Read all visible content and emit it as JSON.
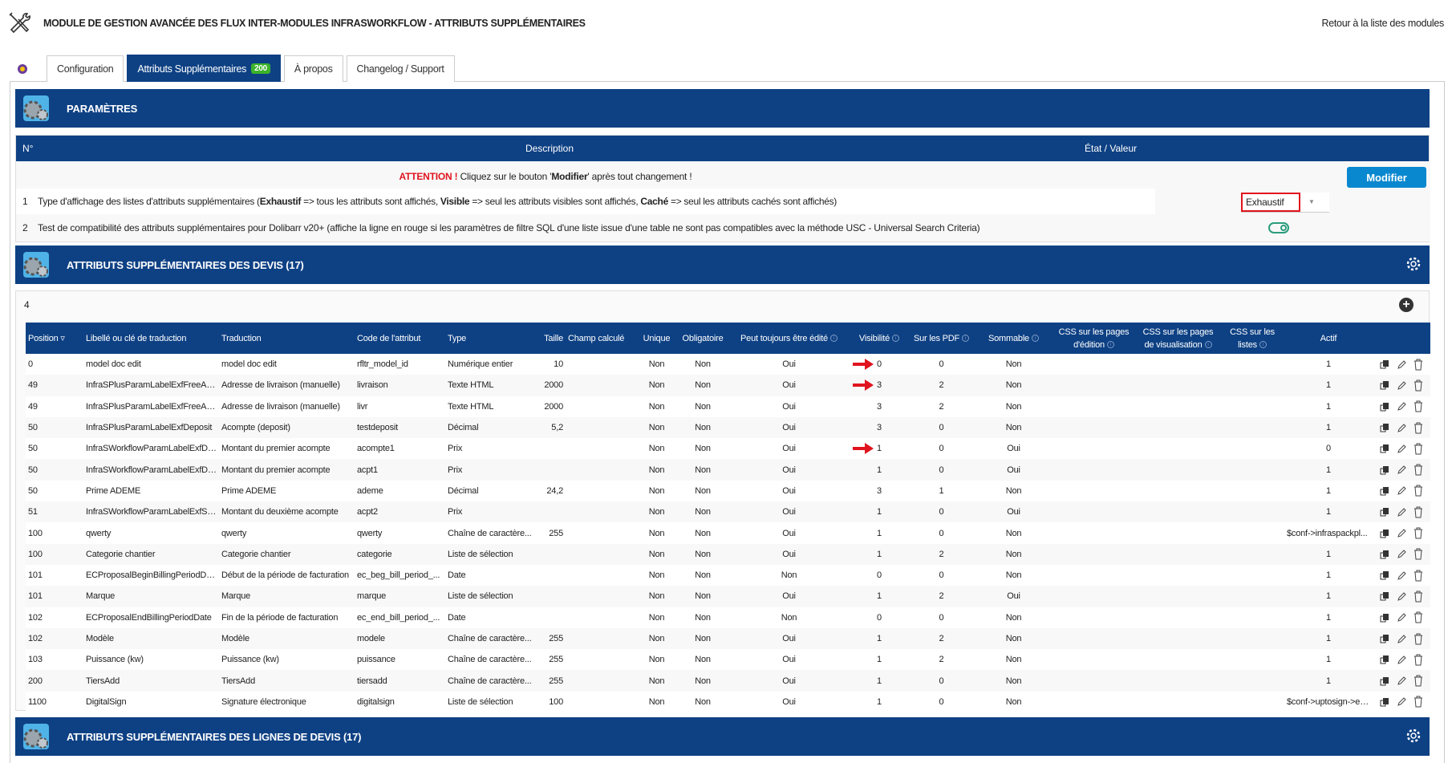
{
  "header": {
    "title": "MODULE DE GESTION AVANCÉE DES FLUX INTER-MODULES INFRASWORKFLOW - ATTRIBUTS SUPPLÉMENTAIRES",
    "back_link": "Retour à la liste des modules"
  },
  "tabs": [
    {
      "label": "Configuration"
    },
    {
      "label": "Attributs Supplémentaires",
      "badge": "200",
      "active": true
    },
    {
      "label": "À propos"
    },
    {
      "label": "Changelog / Support"
    }
  ],
  "params": {
    "title": "PARAMÈTRES",
    "col_num": "N°",
    "col_desc": "Description",
    "col_state": "État / Valeur",
    "attention_label": "ATTENTION !",
    "attention_pre": " Cliquez sur le bouton '",
    "attention_bold": "Modifier",
    "attention_post": "' après tout changement !",
    "modify_button": "Modifier",
    "row1_num": "1",
    "row1_text": "Type d'affichage des listes d'attributs supplémentaires (<b>Exhaustif</b> => tous les attributs sont affichés, <b>Visible</b> => seul les attributs visibles sont affichés, <b>Caché</b> => seul les attributs cachés sont affichés)",
    "row1_value": "Exhaustif",
    "row2_num": "2",
    "row2_text": "Test de compatibilité des attributs supplémentaires pour Dolibarr v20+ (affiche la ligne en rouge si les paramètres de filtre SQL d'une liste issue d'une table ne sont pas compatibles avec la méthode USC - Universal Search Criteria)",
    "row2_toggle_on": true
  },
  "devis": {
    "title": "ATTRIBUTS SUPPLÉMENTAIRES DES DEVIS (17)",
    "count": "4",
    "columns": [
      "Position ▿",
      "Libellé ou clé de traduction",
      "Traduction",
      "Code de l'attribut",
      "Type",
      "Taille",
      "Champ calculé",
      "Unique",
      "Obligatoire",
      "Peut toujours être édité",
      "Visibilité",
      "Sur les PDF",
      "Sommable",
      "CSS sur les pages d'édition",
      "CSS sur les pages de visualisation",
      "CSS sur les listes",
      "Actif"
    ],
    "rows": [
      [
        "0",
        "model doc edit",
        "model doc edit",
        "rfltr_model_id",
        "Numérique entier",
        "10",
        "",
        "Non",
        "Non",
        "Oui",
        "0",
        "0",
        "Non",
        "",
        "",
        "",
        "1",
        true
      ],
      [
        "49",
        "InfraSPlusParamLabelExfFreeAd...",
        "Adresse de livraison (manuelle)",
        "livraison",
        "Texte HTML",
        "2000",
        "",
        "Non",
        "Non",
        "Oui",
        "3",
        "2",
        "Non",
        "",
        "",
        "",
        "1",
        true
      ],
      [
        "49",
        "InfraSPlusParamLabelExfFreeAd...",
        "Adresse de livraison (manuelle)",
        "livr",
        "Texte HTML",
        "2000",
        "",
        "Non",
        "Non",
        "Oui",
        "3",
        "2",
        "Non",
        "",
        "",
        "",
        "1",
        false
      ],
      [
        "50",
        "InfraSPlusParamLabelExfDeposit",
        "Acompte (deposit)",
        "testdeposit",
        "Décimal",
        "5,2",
        "",
        "Non",
        "Non",
        "Oui",
        "3",
        "0",
        "Non",
        "",
        "",
        "",
        "1",
        false
      ],
      [
        "50",
        "InfraSWorkflowParamLabelExfDe...",
        "Montant du premier acompte",
        "acompte1",
        "Prix",
        "",
        "",
        "Non",
        "Non",
        "Oui",
        "1",
        "0",
        "Oui",
        "",
        "",
        "",
        "0",
        true
      ],
      [
        "50",
        "InfraSWorkflowParamLabelExfDe...",
        "Montant du premier acompte",
        "acpt1",
        "Prix",
        "",
        "",
        "Non",
        "Non",
        "Oui",
        "1",
        "0",
        "Oui",
        "",
        "",
        "",
        "1",
        false
      ],
      [
        "50",
        "Prime ADEME",
        "Prime ADEME",
        "ademe",
        "Décimal",
        "24,2",
        "",
        "Non",
        "Non",
        "Oui",
        "3",
        "1",
        "Non",
        "",
        "",
        "",
        "1",
        false
      ],
      [
        "51",
        "InfraSWorkflowParamLabelExfSe...",
        "Montant du deuxième acompte",
        "acpt2",
        "Prix",
        "",
        "",
        "Non",
        "Non",
        "Oui",
        "1",
        "0",
        "Oui",
        "",
        "",
        "",
        "1",
        false
      ],
      [
        "100",
        "qwerty",
        "qwerty",
        "qwerty",
        "Chaîne de caractère...",
        "255",
        "",
        "Non",
        "Non",
        "Oui",
        "1",
        "0",
        "Non",
        "",
        "",
        "",
        "$conf->infraspackpl...",
        false
      ],
      [
        "100",
        "Categorie chantier",
        "Categorie chantier",
        "categorie",
        "Liste de sélection",
        "",
        "",
        "Non",
        "Non",
        "Oui",
        "1",
        "2",
        "Non",
        "",
        "",
        "",
        "1",
        false
      ],
      [
        "101",
        "ECProposalBeginBillingPeriodDate",
        "Début de la période de facturation",
        "ec_beg_bill_period_...",
        "Date",
        "",
        "",
        "Non",
        "Non",
        "Non",
        "0",
        "0",
        "Non",
        "",
        "",
        "",
        "1",
        false
      ],
      [
        "101",
        "Marque",
        "Marque",
        "marque",
        "Liste de sélection",
        "",
        "",
        "Non",
        "Non",
        "Oui",
        "1",
        "2",
        "Oui",
        "",
        "",
        "",
        "1",
        false
      ],
      [
        "102",
        "ECProposalEndBillingPeriodDate",
        "Fin de la période de facturation",
        "ec_end_bill_period_...",
        "Date",
        "",
        "",
        "Non",
        "Non",
        "Non",
        "0",
        "0",
        "Non",
        "",
        "",
        "",
        "1",
        false
      ],
      [
        "102",
        "Modèle",
        "Modèle",
        "modele",
        "Chaîne de caractère...",
        "255",
        "",
        "Non",
        "Non",
        "Oui",
        "1",
        "2",
        "Non",
        "",
        "",
        "",
        "1",
        false
      ],
      [
        "103",
        "Puissance (kw)",
        "Puissance (kw)",
        "puissance",
        "Chaîne de caractère...",
        "255",
        "",
        "Non",
        "Non",
        "Oui",
        "1",
        "2",
        "Non",
        "",
        "",
        "",
        "1",
        false
      ],
      [
        "200",
        "TiersAdd",
        "TiersAdd",
        "tiersadd",
        "Chaîne de caractère...",
        "255",
        "",
        "Non",
        "Non",
        "Oui",
        "1",
        "0",
        "Non",
        "",
        "",
        "",
        "1",
        false
      ],
      [
        "1100",
        "DigitalSign",
        "Signature électronique",
        "digitalsign",
        "Liste de sélection",
        "100",
        "",
        "Non",
        "Non",
        "Oui",
        "1",
        "0",
        "Non",
        "",
        "",
        "",
        "$conf->uptosign->en...",
        false
      ]
    ]
  },
  "lignes": {
    "title": "ATTRIBUTS SUPPLÉMENTAIRES DES LIGNES DE DEVIS (17)"
  },
  "colors": {
    "primary": "#0e4184",
    "button": "#0a88cf",
    "badge": "#3cb32b",
    "arrow": "#e0141e"
  }
}
